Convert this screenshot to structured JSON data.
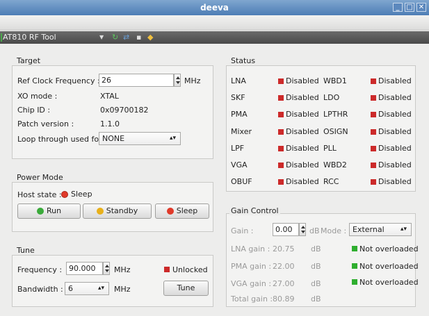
{
  "window": {
    "title": "deeva"
  },
  "toolbar": {
    "tool_name": "AT810 RF Tool"
  },
  "colors": {
    "disabled": "#cc2a2a",
    "ok": "#2fae2f",
    "sleep": "#e03a2a",
    "standby": "#e8b01a",
    "run": "#3aaa3a"
  },
  "target": {
    "title": "Target",
    "ref_clock_label": "Ref Clock Frequency :",
    "ref_clock_value": "26",
    "ref_clock_unit": "MHz",
    "xo_label": "XO mode :",
    "xo_value": "XTAL",
    "chip_label": "Chip ID :",
    "chip_value": "0x09700182",
    "patch_label": "Patch version :",
    "patch_value": "1.1.0",
    "loop_label": "Loop through used for :",
    "loop_value": "NONE"
  },
  "power": {
    "title": "Power Mode",
    "host_label": "Host state :",
    "host_value": "Sleep",
    "run": "Run",
    "standby": "Standby",
    "sleep": "Sleep"
  },
  "tune": {
    "title": "Tune",
    "freq_label": "Frequency :",
    "freq_value": "90.000",
    "freq_unit": "MHz",
    "lock_status": "Unlocked",
    "bw_label": "Bandwidth :",
    "bw_value": "6",
    "bw_unit": "MHz",
    "tune_button": "Tune"
  },
  "status": {
    "title": "Status",
    "rows": [
      {
        "a": "LNA",
        "av": "Disabled",
        "b": "WBD1",
        "bv": "Disabled"
      },
      {
        "a": "SKF",
        "av": "Disabled",
        "b": "LDO",
        "bv": "Disabled"
      },
      {
        "a": "PMA",
        "av": "Disabled",
        "b": "LPTHR",
        "bv": "Disabled"
      },
      {
        "a": "Mixer",
        "av": "Disabled",
        "b": "OSIGN",
        "bv": "Disabled"
      },
      {
        "a": "LPF",
        "av": "Disabled",
        "b": "PLL",
        "bv": "Disabled"
      },
      {
        "a": "VGA",
        "av": "Disabled",
        "b": "WBD2",
        "bv": "Disabled"
      },
      {
        "a": "OBUF",
        "av": "Disabled",
        "b": "RCC",
        "bv": "Disabled"
      }
    ]
  },
  "gain": {
    "title": "Gain Control",
    "gain_label": "Gain :",
    "gain_value": "0.00",
    "gain_unit": "dB",
    "mode_label": "Mode :",
    "mode_value": "External",
    "lna_label": "LNA gain :",
    "lna_value": "20.75",
    "lna_unit": "dB",
    "lna_status": "Not overloaded",
    "pma_label": "PMA gain :",
    "pma_value": "22.00",
    "pma_unit": "dB",
    "pma_status": "Not overloaded",
    "vga_label": "VGA gain :",
    "vga_value": "27.00",
    "vga_unit": "dB",
    "vga_status": "Not overloaded",
    "total_label": "Total gain :",
    "total_value": "80.89",
    "total_unit": "dB"
  }
}
